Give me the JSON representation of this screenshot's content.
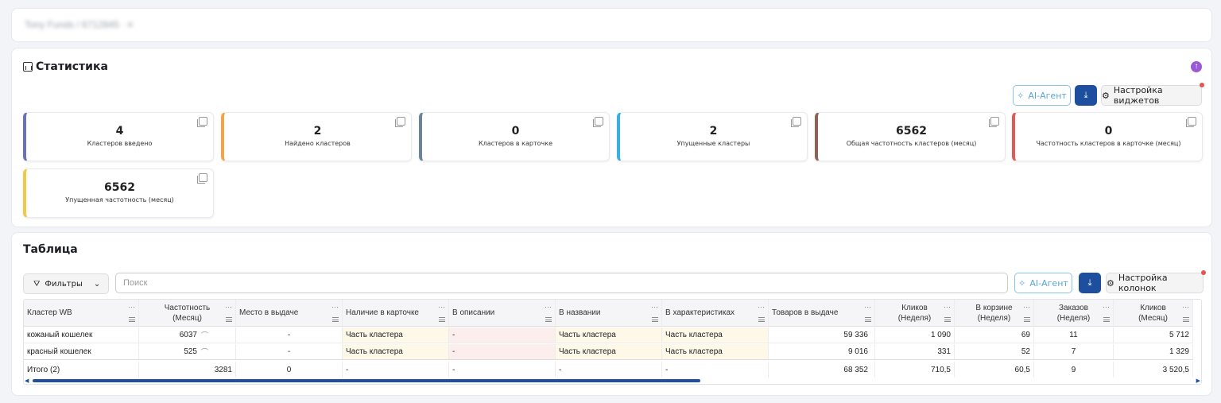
{
  "header": {
    "breadcrumb": "Tony Funds / 6712845 · ≡"
  },
  "stats": {
    "title": "Статистика",
    "ai_agent": "AI-Агент",
    "widgets_settings": "Настройка виджетов",
    "cards": [
      {
        "value": "4",
        "label": "Кластеров введено",
        "color": "#6b72b8"
      },
      {
        "value": "2",
        "label": "Найдено кластеров",
        "color": "#f0a54a"
      },
      {
        "value": "0",
        "label": "Кластеров в карточке",
        "color": "#6b8597"
      },
      {
        "value": "2",
        "label": "Упущенные кластеры",
        "color": "#3ab0e0"
      },
      {
        "value": "6562",
        "label": "Общая частотность кластеров (месяц)",
        "color": "#8b6456"
      },
      {
        "value": "0",
        "label": "Частотность кластеров в карточке (месяц)",
        "color": "#e05a5a"
      },
      {
        "value": "6562",
        "label": "Упущенная частотность (месяц)",
        "color": "#f0c94a"
      }
    ]
  },
  "table": {
    "title": "Таблица",
    "filters": "Фильтры",
    "search_placeholder": "Поиск",
    "ai_agent": "AI-Агент",
    "columns_settings": "Настройка колонок",
    "columns": [
      [
        "Кластер WB",
        ""
      ],
      [
        "Частотность",
        "(Месяц)"
      ],
      [
        "Место в выдаче",
        ""
      ],
      [
        "Наличие в карточке",
        ""
      ],
      [
        "В описании",
        ""
      ],
      [
        "В названии",
        ""
      ],
      [
        "В характеристиках",
        ""
      ],
      [
        "Товаров в выдаче",
        ""
      ],
      [
        "Кликов",
        "(Неделя)"
      ],
      [
        "В корзине",
        "(Неделя)"
      ],
      [
        "Заказов",
        "(Неделя)"
      ],
      [
        "Кликов",
        "(Месяц)"
      ]
    ],
    "rows": [
      [
        "кожаный кошелек",
        "6037",
        "-",
        "Часть кластера",
        "-",
        "Часть кластера",
        "Часть кластера",
        "59 336",
        "1 090",
        "69",
        "11",
        "5 712"
      ],
      [
        "красный кошелек",
        "525",
        "-",
        "Часть кластера",
        "-",
        "Часть кластера",
        "Часть кластера",
        "9 016",
        "331",
        "52",
        "7",
        "1 329"
      ]
    ],
    "total": [
      "Итого (2)",
      "3281",
      "0",
      "-",
      "-",
      "-",
      "-",
      "68 352",
      "710,5",
      "60,5",
      "9",
      "3 520,5"
    ]
  }
}
